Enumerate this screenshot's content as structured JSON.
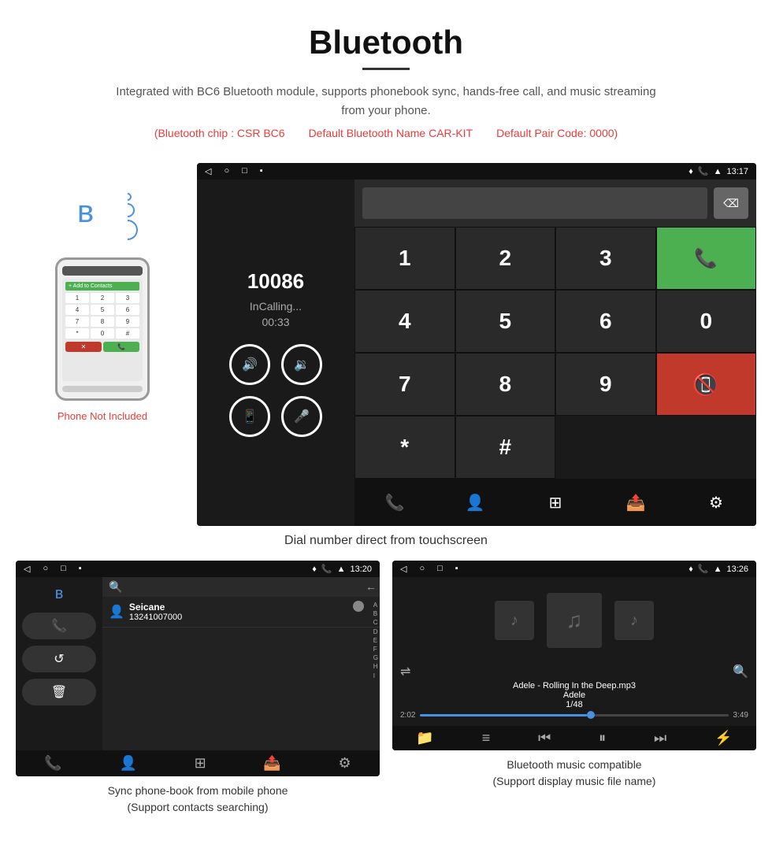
{
  "header": {
    "title": "Bluetooth",
    "subtitle": "Integrated with BC6 Bluetooth module, supports phonebook sync, hands-free call, and music streaming from your phone.",
    "spec1": "(Bluetooth chip : CSR BC6",
    "spec2": "Default Bluetooth Name CAR-KIT",
    "spec3": "Default Pair Code: 0000)"
  },
  "phone_label": "Phone Not Included",
  "call_screen": {
    "number": "10086",
    "status": "InCalling...",
    "timer": "00:33",
    "time": "13:17",
    "dialpad": [
      "1",
      "2",
      "3",
      "*",
      "4",
      "5",
      "6",
      "0",
      "7",
      "8",
      "9",
      "#"
    ]
  },
  "caption_main": "Dial number direct from touchscreen",
  "phonebook_screen": {
    "time": "13:20",
    "contact_name": "Seicane",
    "contact_number": "13241007000",
    "alpha_list": [
      "A",
      "B",
      "C",
      "D",
      "E",
      "F",
      "G",
      "H",
      "I"
    ]
  },
  "caption_phonebook_line1": "Sync phone-book from mobile phone",
  "caption_phonebook_line2": "(Support contacts searching)",
  "music_screen": {
    "time": "13:26",
    "track": "Adele - Rolling In the Deep.mp3",
    "artist": "Adele",
    "track_num": "1/48",
    "time_elapsed": "2:02",
    "time_total": "3:49"
  },
  "caption_music_line1": "Bluetooth music compatible",
  "caption_music_line2": "(Support display music file name)"
}
